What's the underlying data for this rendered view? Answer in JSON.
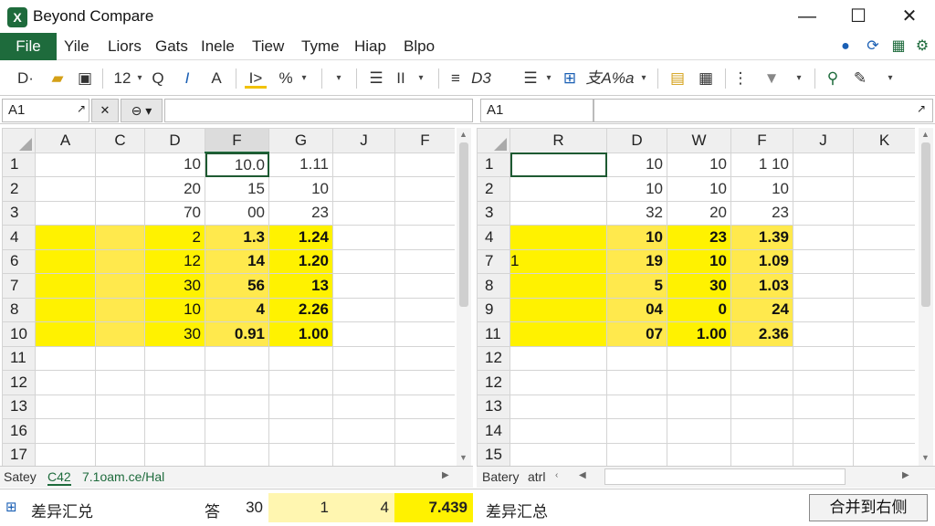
{
  "window": {
    "title": "Beyond Compare",
    "icon_letter": "X",
    "min": "—",
    "max": "☐",
    "close": "✕"
  },
  "menu": {
    "file": "File",
    "items": [
      "Yile",
      "Liors",
      "Gats",
      "Inele",
      "Tiew",
      "Tyme",
      "Hiap",
      "Blpo"
    ]
  },
  "toolbar": {
    "t1": "D·",
    "t2": "▾",
    "t3": "12",
    "t4": "Q",
    "t5": "I",
    "t6": "A",
    "t7": "I>",
    "t8": "%",
    "t9": "II",
    "t10": "D3",
    "t11": "支A%a"
  },
  "left_name": "A1",
  "right_name": "A1",
  "left_grid": {
    "columns": [
      "A",
      "C",
      "D",
      "F",
      "G",
      "J",
      "F"
    ],
    "rows": [
      {
        "h": "1",
        "cells": [
          "",
          "",
          "10",
          "10.0",
          "1.11",
          "",
          ""
        ]
      },
      {
        "h": "2",
        "cells": [
          "",
          "",
          "20",
          "15",
          "10",
          "",
          ""
        ]
      },
      {
        "h": "3",
        "cells": [
          "",
          "",
          "70",
          "00",
          "23",
          "",
          ""
        ]
      },
      {
        "h": "4",
        "cells": [
          "",
          "",
          "2",
          "1.3",
          "1.24",
          "",
          ""
        ]
      },
      {
        "h": "6",
        "cells": [
          "",
          "",
          "12",
          "14",
          "1.20",
          "",
          ""
        ]
      },
      {
        "h": "7",
        "cells": [
          "",
          "",
          "30",
          "56",
          "13",
          "",
          ""
        ]
      },
      {
        "h": "8",
        "cells": [
          "",
          "",
          "10",
          "4",
          "2.26",
          "",
          ""
        ]
      },
      {
        "h": "10",
        "cells": [
          "",
          "",
          "30",
          "0.91",
          "1.00",
          "",
          ""
        ]
      },
      {
        "h": "11",
        "cells": [
          "",
          "",
          "",
          "",
          "",
          "",
          ""
        ]
      },
      {
        "h": "12",
        "cells": [
          "",
          "",
          "",
          "",
          "",
          "",
          ""
        ]
      },
      {
        "h": "13",
        "cells": [
          "",
          "",
          "",
          "",
          "",
          "",
          ""
        ]
      },
      {
        "h": "16",
        "cells": [
          "",
          "",
          "",
          "",
          "",
          "",
          ""
        ]
      },
      {
        "h": "17",
        "cells": [
          "",
          "",
          "",
          "",
          "",
          "",
          ""
        ]
      }
    ]
  },
  "right_grid": {
    "columns": [
      "R",
      "D",
      "W",
      "F",
      "J",
      "K"
    ],
    "rows": [
      {
        "h": "1",
        "cells": [
          "",
          "10",
          "10",
          "1 10",
          "",
          ""
        ]
      },
      {
        "h": "2",
        "cells": [
          "",
          "10",
          "10",
          "10",
          "",
          ""
        ]
      },
      {
        "h": "3",
        "cells": [
          "",
          "32",
          "20",
          "23",
          "",
          ""
        ]
      },
      {
        "h": "4",
        "cells": [
          "",
          "10",
          "23",
          "1.39",
          "",
          ""
        ]
      },
      {
        "h": "7",
        "cells": [
          "1",
          "19",
          "10",
          "1.09",
          "",
          ""
        ]
      },
      {
        "h": "8",
        "cells": [
          "",
          "5",
          "30",
          "1.03",
          "",
          ""
        ]
      },
      {
        "h": "9",
        "cells": [
          "",
          "04",
          "0",
          "24",
          "",
          ""
        ]
      },
      {
        "h": "11",
        "cells": [
          "",
          "07",
          "1.00",
          "2.36",
          "",
          ""
        ]
      },
      {
        "h": "12",
        "cells": [
          "",
          "",
          "",
          "",
          "",
          ""
        ]
      },
      {
        "h": "12",
        "cells": [
          "",
          "",
          "",
          "",
          "",
          ""
        ]
      },
      {
        "h": "13",
        "cells": [
          "",
          "",
          "",
          "",
          "",
          ""
        ]
      },
      {
        "h": "14",
        "cells": [
          "",
          "",
          "",
          "",
          "",
          ""
        ]
      },
      {
        "h": "15",
        "cells": [
          "",
          "",
          "",
          "",
          "",
          ""
        ]
      }
    ]
  },
  "left_sheet_tabs": [
    "Satey",
    "C42",
    "7.1oam.ce/Hal"
  ],
  "right_sheet_tabs": [
    "Batery",
    "atrl"
  ],
  "status": {
    "label_left": "差异汇兑",
    "sym": "答",
    "n1": "30",
    "n2": "1",
    "n3": "4",
    "n4": "7.439",
    "label_right": "差异汇总",
    "merge_button": "合并到右侧"
  },
  "colors": {
    "accent": "#1e6b3c",
    "highlight": "#fff200"
  }
}
